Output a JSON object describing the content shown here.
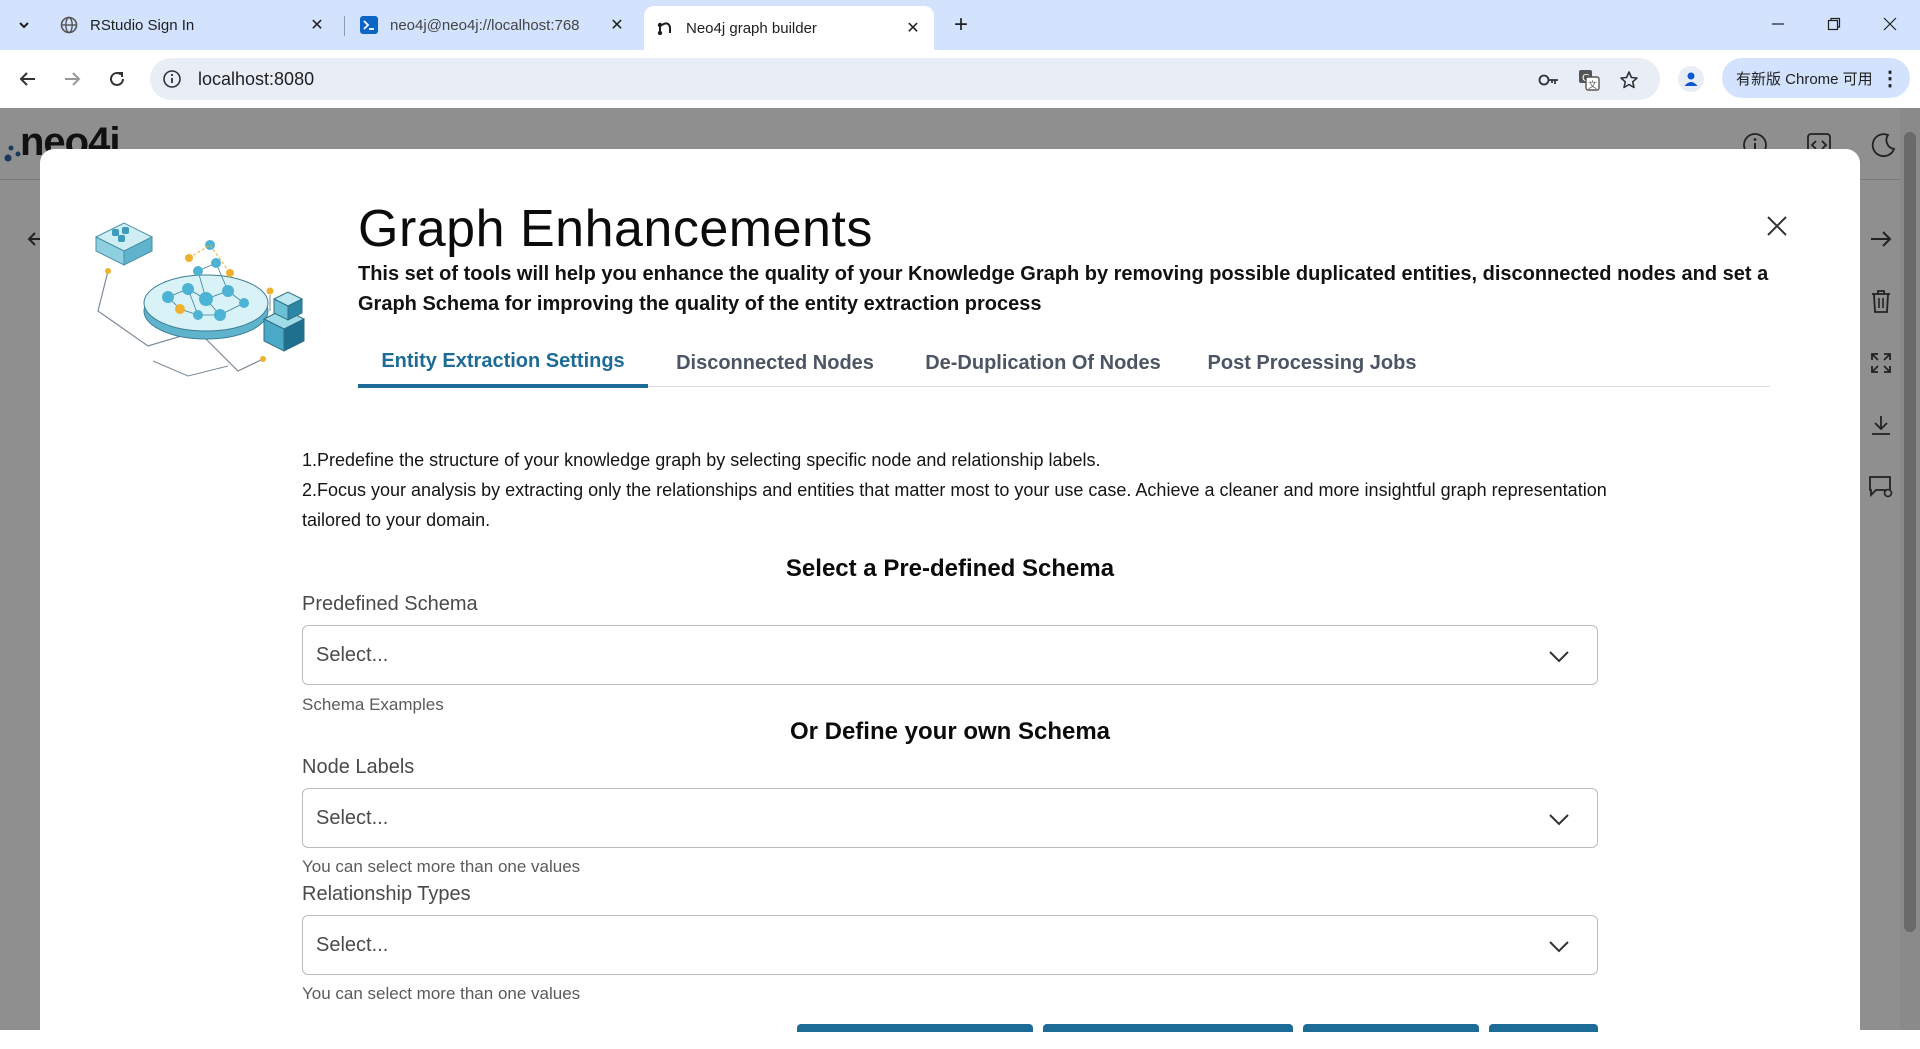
{
  "browser": {
    "tabs": [
      {
        "title": "RStudio Sign In",
        "icon": "globe-icon"
      },
      {
        "title": "neo4j@neo4j://localhost:768",
        "icon": "terminal-icon"
      },
      {
        "title": "Neo4j graph builder",
        "icon": "neo4j-icon",
        "active": true
      }
    ],
    "url": "localhost:8080",
    "chrome_available_label": "有新版 Chrome 可用"
  },
  "app": {
    "logo_text": "neo4j"
  },
  "modal": {
    "title": "Graph Enhancements",
    "description": "This set of tools will help you enhance the quality of your Knowledge Graph by removing possible duplicated entities, disconnected nodes and set a Graph Schema for improving the quality of the entity extraction process",
    "tabs": [
      {
        "label": "Entity Extraction Settings",
        "active": true
      },
      {
        "label": "Disconnected Nodes"
      },
      {
        "label": "De-Duplication Of Nodes"
      },
      {
        "label": "Post Processing Jobs"
      }
    ],
    "intro_line1": "1.Predefine the structure of your knowledge graph by selecting specific node and relationship labels.",
    "intro_line2": "2.Focus your analysis by extracting only the relationships and entities that matter most to your use case. Achieve a cleaner and more insightful graph representation tailored to your domain.",
    "predefined_heading": "Select a Pre-defined Schema",
    "predefined_label": "Predefined Schema",
    "predefined_value": "Select...",
    "predefined_help": "Schema Examples",
    "own_heading": "Or Define your own Schema",
    "node_labels_label": "Node Labels",
    "node_labels_value": "Select...",
    "node_labels_help": "You can select more than one values",
    "rel_types_label": "Relationship Types",
    "rel_types_value": "Select...",
    "rel_types_help": "You can select more than one values"
  },
  "colors": {
    "accent": "#1d6b97",
    "tabstrip": "#d3e3fd"
  }
}
